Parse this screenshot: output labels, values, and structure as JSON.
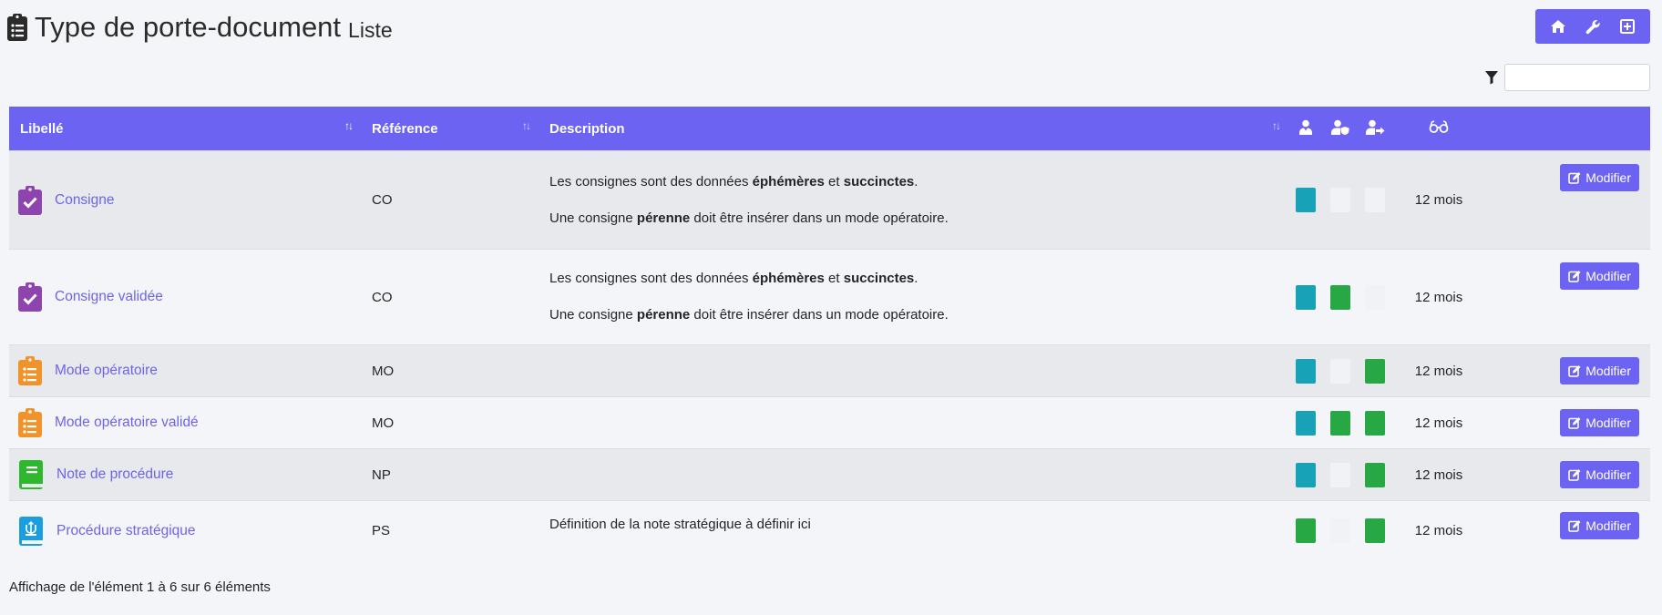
{
  "page": {
    "title": "Type de porte-document",
    "subtitle": "Liste"
  },
  "filter": {
    "value": "",
    "placeholder": ""
  },
  "table": {
    "columns": {
      "libelle": "Libellé",
      "reference": "Référence",
      "description": "Description"
    },
    "rows": [
      {
        "icon": "clipboard-check-icon",
        "icon_color": "#8e44ad",
        "libelle": "Consigne",
        "reference": "CO",
        "desc_p1": {
          "a": "Les consignes sont des données ",
          "b": "éphémères",
          "c": " et ",
          "d": "succinctes",
          "e": "."
        },
        "desc_p2": {
          "a": "Une consigne ",
          "b": "pérenne",
          "c": " doit être insérer dans un mode opératoire."
        },
        "squares": [
          "#17a2b8",
          "#f1f2f5",
          "#f1f2f5"
        ],
        "duration": "12 mois",
        "action": "Modifier"
      },
      {
        "icon": "clipboard-check-icon",
        "icon_color": "#8e44ad",
        "libelle": "Consigne validée",
        "reference": "CO",
        "desc_p1": {
          "a": "Les consignes sont des données ",
          "b": "éphémères",
          "c": " et ",
          "d": "succinctes",
          "e": "."
        },
        "desc_p2": {
          "a": "Une consigne ",
          "b": "pérenne",
          "c": " doit être insérer dans un mode opératoire."
        },
        "squares": [
          "#17a2b8",
          "#28a745",
          "#f1f2f5"
        ],
        "duration": "12 mois",
        "action": "Modifier"
      },
      {
        "icon": "clipboard-list-icon",
        "icon_color": "#f0932b",
        "libelle": "Mode opératoire",
        "reference": "MO",
        "squares": [
          "#17a2b8",
          "#f1f2f5",
          "#28a745"
        ],
        "duration": "12 mois",
        "action": "Modifier"
      },
      {
        "icon": "clipboard-list-icon",
        "icon_color": "#f0932b",
        "libelle": "Mode opératoire validé",
        "reference": "MO",
        "squares": [
          "#17a2b8",
          "#28a745",
          "#28a745"
        ],
        "duration": "12 mois",
        "action": "Modifier"
      },
      {
        "icon": "book-icon",
        "icon_color": "#2eb82e",
        "libelle": "Note de procédure",
        "reference": "NP",
        "squares": [
          "#17a2b8",
          "#f1f2f5",
          "#28a745"
        ],
        "duration": "12 mois",
        "action": "Modifier"
      },
      {
        "icon": "book-emblem-icon",
        "icon_color": "#1a9ee0",
        "libelle": "Procédure stratégique",
        "reference": "PS",
        "desc_single": "Définition de la note stratégique à définir ici",
        "squares": [
          "#28a745",
          "#f1f2f5",
          "#28a745"
        ],
        "duration": "12 mois",
        "action": "Modifier"
      }
    ]
  },
  "footer": {
    "info": "Affichage de l'élément 1 à 6 sur 6 éléments"
  },
  "colors": {
    "accent": "#6c63f2",
    "link": "#6d64e8",
    "info": "#17a2b8",
    "success": "#28a745"
  }
}
